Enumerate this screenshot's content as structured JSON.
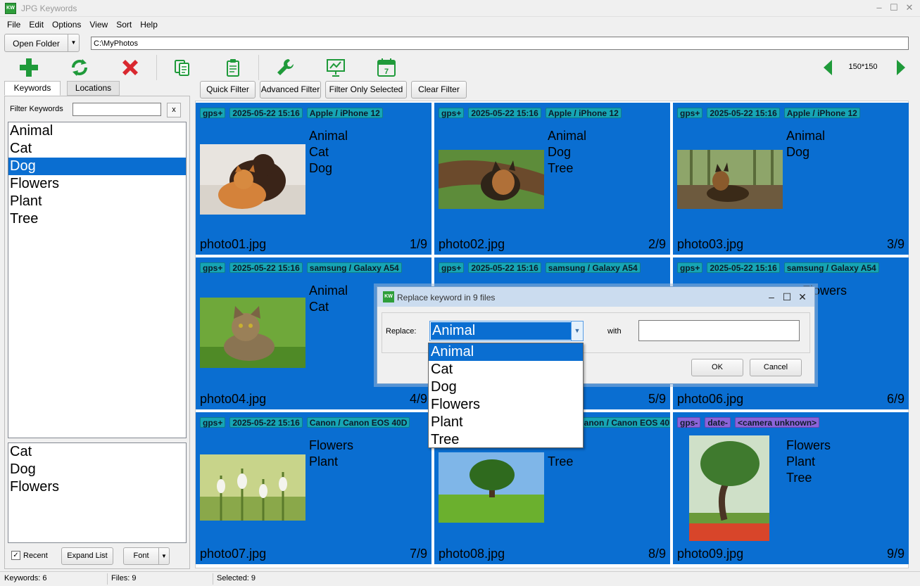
{
  "window": {
    "title": "JPG Keywords",
    "icon": "KW"
  },
  "menu": [
    "File",
    "Edit",
    "Options",
    "View",
    "Sort",
    "Help"
  ],
  "folder": {
    "button_label": "Open Folder",
    "path": "C:\\MyPhotos"
  },
  "toolbar": {
    "icons": [
      "add-icon",
      "refresh-icon",
      "delete-icon",
      "copy-icon",
      "paste-icon",
      "wrench-icon",
      "slideshow-icon",
      "calendar-icon",
      "prev-icon",
      "next-icon"
    ],
    "calendar_day": "7",
    "thumb_size": "150*150"
  },
  "tabs": [
    "Keywords",
    "Locations"
  ],
  "filter_buttons": [
    "Quick Filter",
    "Advanced Filter",
    "Filter Only Selected",
    "Clear Filter"
  ],
  "left": {
    "filter_label": "Filter Keywords",
    "filter_value": "",
    "clear_label": "x",
    "keywords": [
      "Animal",
      "Cat",
      "Dog",
      "Flowers",
      "Plant",
      "Tree"
    ],
    "selected_keyword": "Dog",
    "recent_keywords": [
      "Cat",
      "Dog",
      "Flowers"
    ],
    "recent_checked": true,
    "recent_check_mark": "✓",
    "recent_label": "Recent",
    "expand_label": "Expand List",
    "font_label": "Font"
  },
  "photos": [
    {
      "tags": [
        "gps+",
        "2025-05-22 15:16",
        "Apple / iPhone 12"
      ],
      "keywords": [
        "Animal",
        "Cat",
        "Dog"
      ],
      "file": "photo01.jpg",
      "index": "1/9"
    },
    {
      "tags": [
        "gps+",
        "2025-05-22 15:16",
        "Apple / iPhone 12"
      ],
      "keywords": [
        "Animal",
        "Dog",
        "Tree"
      ],
      "file": "photo02.jpg",
      "index": "2/9"
    },
    {
      "tags": [
        "gps+",
        "2025-05-22 15:16",
        "Apple / iPhone 12"
      ],
      "keywords": [
        "Animal",
        "Dog"
      ],
      "file": "photo03.jpg",
      "index": "3/9"
    },
    {
      "tags": [
        "gps+",
        "2025-05-22 15:16",
        "samsung / Galaxy A54"
      ],
      "keywords": [
        "Animal",
        "Cat"
      ],
      "file": "photo04.jpg",
      "index": "4/9"
    },
    {
      "tags": [
        "gps+",
        "2025-05-22 15:16",
        "samsung / Galaxy A54"
      ],
      "keywords": [],
      "file": "",
      "index": "5/9"
    },
    {
      "tags": [
        "gps+",
        "2025-05-22 15:16",
        "samsung / Galaxy A54"
      ],
      "keywords": [
        "Flowers"
      ],
      "file": "photo06.jpg",
      "index": "6/9"
    },
    {
      "tags": [
        "gps+",
        "2025-05-22 15:16",
        "Canon / Canon EOS 40D"
      ],
      "keywords": [
        "Flowers",
        "Plant"
      ],
      "file": "photo07.jpg",
      "index": "7/9"
    },
    {
      "tags": [
        "gps+",
        "2025-05-22 15:16",
        "Canon / Canon EOS 40D"
      ],
      "keywords": [
        "Tree"
      ],
      "file": "photo08.jpg",
      "index": "8/9"
    },
    {
      "tags": [
        "gps-",
        "date-",
        "<camera unknown>"
      ],
      "keywords": [
        "Flowers",
        "Plant",
        "Tree"
      ],
      "file": "photo09.jpg",
      "index": "9/9"
    }
  ],
  "dialog": {
    "title": "Replace keyword in 9 files",
    "replace_label": "Replace:",
    "replace_value": "Animal",
    "with_label": "with",
    "with_value": "",
    "ok_label": "OK",
    "cancel_label": "Cancel",
    "options": [
      "Animal",
      "Cat",
      "Dog",
      "Flowers",
      "Plant",
      "Tree"
    ],
    "selected_option": "Animal"
  },
  "status": {
    "keywords": "Keywords: 6",
    "files": "Files: 9",
    "selected": "Selected: 9"
  },
  "colors": {
    "cell_bg": "#0a6ed1",
    "tag_teal": "#16a5b5",
    "tag_purple": "#8b64d9",
    "icon_green": "#1f9a3a",
    "icon_red": "#d9282f"
  }
}
